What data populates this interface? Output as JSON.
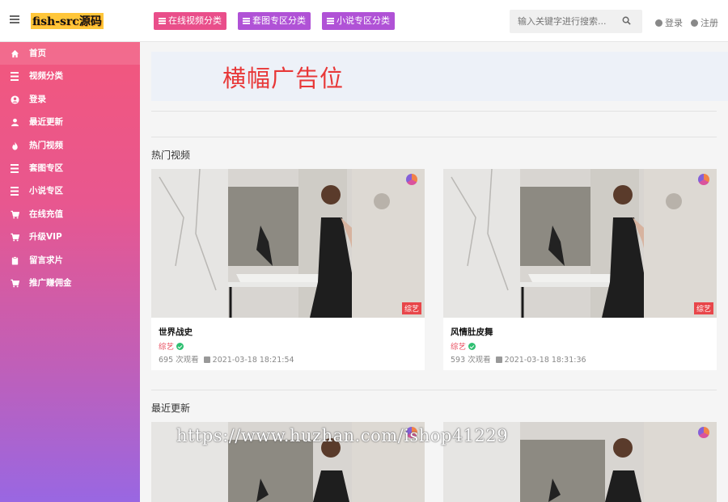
{
  "header": {
    "logo": "fish-src源码",
    "categories": [
      {
        "label": "在线视频分类"
      },
      {
        "label": "套图专区分类"
      },
      {
        "label": "小说专区分类"
      }
    ],
    "search_placeholder": "输入关键字进行搜索...",
    "login": "登录",
    "register": "注册"
  },
  "sidebar": {
    "items": [
      {
        "label": "首页",
        "icon": "home-icon"
      },
      {
        "label": "视频分类",
        "icon": "list-icon"
      },
      {
        "label": "登录",
        "icon": "user-circle-icon"
      },
      {
        "label": "最近更新",
        "icon": "user-icon"
      },
      {
        "label": "热门视频",
        "icon": "fire-icon"
      },
      {
        "label": "套图专区",
        "icon": "list-icon"
      },
      {
        "label": "小说专区",
        "icon": "list-icon"
      },
      {
        "label": "在线充值",
        "icon": "cart-icon"
      },
      {
        "label": "升级VIP",
        "icon": "cart-icon"
      },
      {
        "label": "留言求片",
        "icon": "clipboard-icon"
      },
      {
        "label": "推广赚佣金",
        "icon": "cart-icon"
      }
    ]
  },
  "banner": {
    "text": "横幅广告位"
  },
  "hot": {
    "title": "热门视频",
    "cards": [
      {
        "title": "世界战史",
        "category": "综艺",
        "views": "695 次观看",
        "date": "2021-03-18 18:21:54",
        "tag": "综艺"
      },
      {
        "title": "风情肚皮舞",
        "category": "综艺",
        "views": "593 次观看",
        "date": "2021-03-18 18:31:36",
        "tag": "综艺"
      }
    ]
  },
  "recent": {
    "title": "最近更新"
  },
  "watermark": "https://www.huzhan.com/ishop41229"
}
